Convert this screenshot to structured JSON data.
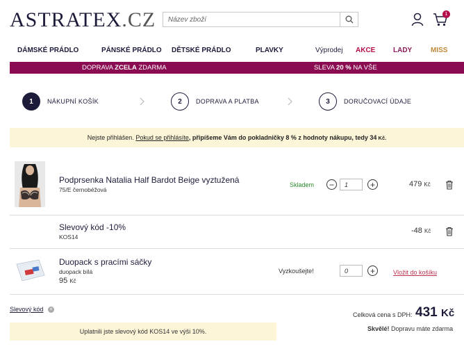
{
  "header": {
    "logo_main": "ASTRATEX",
    "logo_suffix": ".CZ",
    "search_placeholder": "Název zboží",
    "search_icon": "search-icon",
    "user_icon": "user-icon",
    "cart_icon": "cart-icon",
    "cart_count": "1"
  },
  "nav": {
    "items": [
      "DÁMSKÉ PRÁDLO",
      "PÁNSKÉ PRÁDLO",
      "DĚTSKÉ PRÁDLO",
      "PLAVKY",
      "Výprodej",
      "AKCE",
      "LADY",
      "MISS"
    ]
  },
  "promo": {
    "left_pre": "DOPRAVA ",
    "left_bold": "ZCELA",
    "left_post": " ZDARMA",
    "right_pre": "SLEVA ",
    "right_bold": "20 %",
    "right_post": " NA VŠE"
  },
  "steps": [
    {
      "num": "1",
      "label": "NÁKUPNÍ KOŠÍK"
    },
    {
      "num": "2",
      "label": "DOPRAVA A PLATBA"
    },
    {
      "num": "3",
      "label": "DORUČOVACÍ ÚDAJE"
    }
  ],
  "notice": {
    "pre": "Nejste přihlášen. ",
    "link": "Pokud se přihlásíte",
    "mid": ", připíšeme Vám do pokladničky ",
    "bold": "8 % z hodnoty nákupu, tedy 34",
    "currency": " Kč."
  },
  "cart": {
    "item1": {
      "name": "Podprsenka Natalia Half Bardot Beige vyztužená",
      "variant": "75/E černobéžová",
      "stock": "Skladem",
      "qty": "1",
      "price": "479",
      "currency": "Kč"
    },
    "discount": {
      "name": "Slevový kód -10%",
      "code": "KOS14",
      "price": "-48",
      "currency": "Kč"
    },
    "item3": {
      "name": "Duopack s pracími sáčky",
      "variant": "duopack bílá",
      "price": "95",
      "currency": "Kč",
      "try_label": "Vyzkoušejte!",
      "qty": "0",
      "add_link": "Vložit do košíku"
    }
  },
  "footer": {
    "coupon_link": "Slevový kód",
    "total_label": "Celková cena s DPH:",
    "total_value": "431",
    "total_currency": "Kč",
    "free_bold": "Skvělé!",
    "free_text": " Dopravu máte zdarma",
    "applied": "Uplatnili jste slevový kód KOS14 ve výši 10%."
  },
  "colors": {
    "brand_navy": "#1c1c3a",
    "promo_bg": "#8b0b52",
    "notice_bg": "#fdf5d8",
    "stock_green": "#2e8b2e",
    "accent_red": "#b50c4b"
  }
}
